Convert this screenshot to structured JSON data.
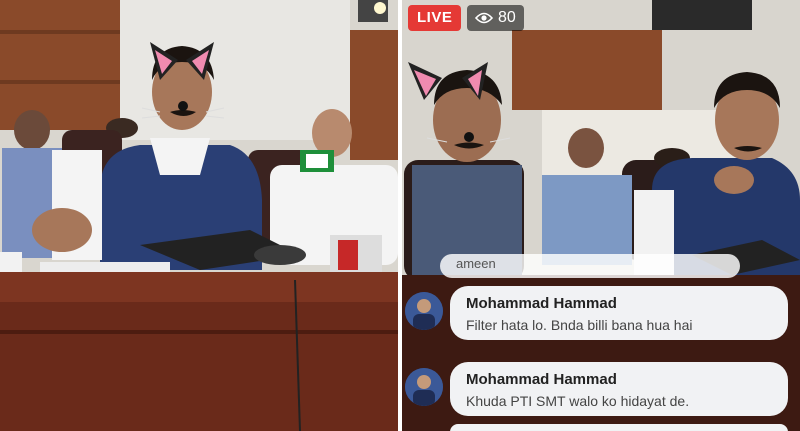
{
  "live": {
    "badge_label": "LIVE",
    "viewer_count": "80",
    "viewer_icon": "eye-icon",
    "live_color": "#e53935"
  },
  "comments": {
    "partial_text": "ameen",
    "items": [
      {
        "author": "Mohammad Hammad",
        "text": "Filter hata lo. Bnda billi bana hua hai"
      },
      {
        "author": "Mohammad Hammad",
        "text": "Khuda PTI SMT walo ko hidayat de."
      }
    ]
  }
}
